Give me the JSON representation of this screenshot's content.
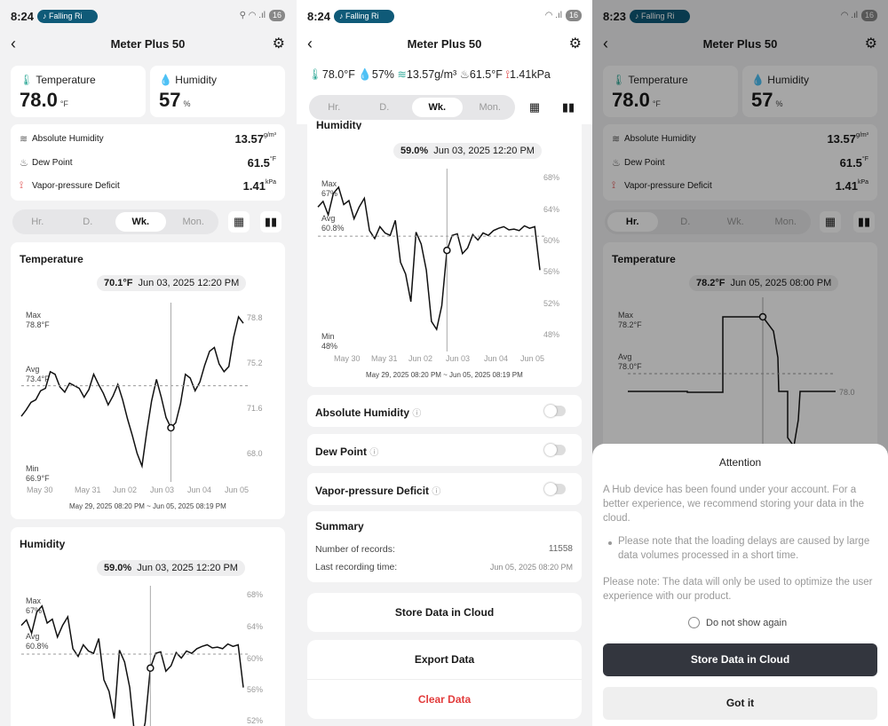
{
  "status": {
    "p1_time": "8:24",
    "p2_time": "8:24",
    "p3_time": "8:23",
    "now_playing": "♪ Falling Ri",
    "battery": "16",
    "wifi_p1": "⚲ ◠ .ıl",
    "wifi_p2": "◠ .ıl",
    "wifi_p3": "◠ .ıl"
  },
  "nav": {
    "title": "Meter Plus 50",
    "back": "‹",
    "gear": "⚙"
  },
  "metrics": {
    "temp_label": "Temperature",
    "temp_value": "78.0",
    "temp_unit": "°F",
    "hum_label": "Humidity",
    "hum_value": "57",
    "hum_unit": "%"
  },
  "p3_metrics": {
    "temp_value": "78.0",
    "hum_value": "57"
  },
  "details": [
    {
      "label": "Absolute Humidity",
      "value": "13.57",
      "unit": "g/m³",
      "icon": "≋"
    },
    {
      "label": "Dew Point",
      "value": "61.5",
      "unit": "°F",
      "icon": "♨"
    },
    {
      "label": "Vapor-pressure Deficit",
      "value": "1.41",
      "unit": "kPa",
      "icon": "⟟"
    }
  ],
  "summary_strip": {
    "temp": "78.0°F",
    "hum": "57%",
    "abs": "13.57g/m³",
    "dew": "61.5°F",
    "vpd": "1.41kPa"
  },
  "tabs": [
    "Hr.",
    "D.",
    "Wk.",
    "Mon."
  ],
  "icons": {
    "calendar": "▦",
    "bars": "▮▮"
  },
  "temp_chart": {
    "title": "Temperature",
    "tip_value": "70.1°F",
    "tip_date": "Jun 03, 2025 12:20 PM",
    "max_label": "Max",
    "max_value": "78.8°F",
    "avg_label": "Avg",
    "avg_value": "73.4°F",
    "min_label": "Min",
    "min_value": "66.9°F",
    "y_ticks": [
      "78.8",
      "75.2",
      "71.6",
      "68.0"
    ],
    "x_ticks": [
      "May 30",
      "May 31",
      "Jun 02",
      "Jun 03",
      "Jun 04",
      "Jun 05"
    ],
    "range": "May 29, 2025 08:20 PM ~ Jun 05, 2025 08:19 PM"
  },
  "hum_chart": {
    "title": "Humidity",
    "tip_value": "59.0%",
    "tip_date": "Jun 03, 2025 12:20 PM",
    "max_label": "Max",
    "max_value": "67%",
    "avg_label": "Avg",
    "avg_value": "60.8%",
    "min_label": "Min",
    "min_value": "48%",
    "y_ticks": [
      "68%",
      "64%",
      "60%",
      "56%",
      "52%",
      "48%"
    ],
    "x_ticks": [
      "May 30",
      "May 31",
      "Jun 02",
      "Jun 03",
      "Jun 04",
      "Jun 05"
    ],
    "range": "May 29, 2025 08:20 PM ~ Jun 05, 2025 08:19 PM",
    "cut_title": "Humidity"
  },
  "p3_chart": {
    "title": "Temperature",
    "tip_value": "78.2°F",
    "tip_date": "Jun 05, 2025 08:00 PM",
    "max_label": "Max",
    "max_value": "78.2°F",
    "avg_label": "Avg",
    "avg_value": "78.0°F",
    "y_tick": "78.0"
  },
  "toggles": [
    {
      "label": "Absolute Humidity"
    },
    {
      "label": "Dew Point"
    },
    {
      "label": "Vapor-pressure Deficit"
    }
  ],
  "info_icon": "ⓘ",
  "summary": {
    "title": "Summary",
    "records_label": "Number of records:",
    "records_value": "11558",
    "last_label": "Last recording time:",
    "last_value": "Jun 05, 2025 08:20 PM"
  },
  "buttons": {
    "store": "Store Data in Cloud",
    "export": "Export Data",
    "clear": "Clear Data"
  },
  "dialog": {
    "title": "Attention",
    "body": "A Hub device has been found under your account. For a better experience, we recommend storing your data in the cloud.",
    "bullet": "Please note that the loading delays are caused by large data volumes processed in a short time.",
    "note": "Please note: The data will only be used to optimize the user experience with our product.",
    "checkbox": "Do not show again",
    "primary": "Store Data in Cloud",
    "secondary": "Got it"
  },
  "chart_data": [
    {
      "type": "line",
      "title": "Temperature",
      "series": [
        {
          "values": [
            71.0,
            71.5,
            72.1,
            72.3,
            73.0,
            73.2,
            74.5,
            74.3,
            73.3,
            72.9,
            73.6,
            73.4,
            73.2,
            72.5,
            73.1,
            74.3,
            73.5,
            72.8,
            71.9,
            72.6,
            73.5,
            72.3,
            70.8,
            69.5,
            68.1,
            67.1,
            69.8,
            72.2,
            73.9,
            72.5,
            70.9,
            70.1,
            70.5,
            72.0,
            74.3,
            74.0,
            73.0,
            73.7,
            75.0,
            76.1,
            76.4,
            75.1,
            74.5,
            74.9,
            77.2,
            78.8,
            78.3
          ]
        }
      ],
      "x": [
        "May 30",
        "May 31",
        "Jun 02",
        "Jun 03",
        "Jun 04",
        "Jun 05"
      ],
      "ylim": [
        66.9,
        78.8
      ],
      "xlabel": "May 29, 2025 08:20 PM ~ Jun 05, 2025 08:19 PM"
    },
    {
      "type": "line",
      "title": "Humidity",
      "series": [
        {
          "values": [
            64.5,
            65.2,
            63.5,
            66.2,
            67.0,
            64.8,
            65.3,
            63.0,
            64.5,
            65.6,
            61.5,
            60.5,
            62.0,
            61.2,
            60.9,
            62.8,
            57.5,
            56.0,
            52.5,
            61.3,
            59.8,
            56.5,
            50.0,
            49.0,
            52.0,
            59.0,
            60.9,
            61.1,
            58.6,
            59.3,
            61.0,
            60.3,
            61.2,
            60.9,
            61.5,
            61.8,
            62.0,
            61.6,
            61.7,
            61.5,
            62.1,
            61.8,
            62.0,
            56.5
          ]
        }
      ],
      "x": [
        "May 30",
        "May 31",
        "Jun 02",
        "Jun 03",
        "Jun 04",
        "Jun 05"
      ],
      "ylim": [
        48,
        68
      ],
      "xlabel": "May 29, 2025 08:20 PM ~ Jun 05, 2025 08:19 PM"
    }
  ]
}
